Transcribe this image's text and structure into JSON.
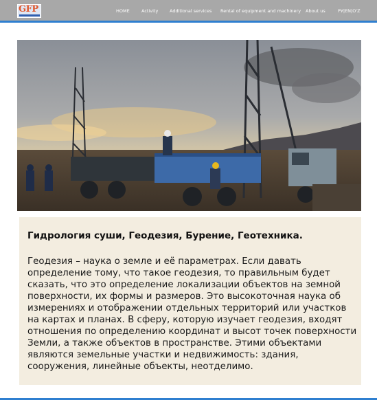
{
  "brand": {
    "logo_text": "GFP"
  },
  "nav": {
    "items": [
      "HOME",
      "Activity",
      "Additional services",
      "Rental of equipment and machinery",
      "About us",
      "РУ|EN|O'Z"
    ]
  },
  "colors": {
    "topbar": "#a8a8a8",
    "accent": "#2f7fd0",
    "text_panel": "#f3ede0"
  },
  "content": {
    "heading": "Гидрология суши, Геодезия, Бурение, Геотехника.",
    "paragraph": "Геодезия – наука о земле и её параметрах. Если давать определение тому, что такое геодезия, то правильным будет сказать, что это определение локализации объектов на земной поверхности, их формы и размеров. Это высокоточная наука об измерениях и отображении отдельных территорий или участков на картах и планах. В сферу, которую изучает геодезия, входят отношения по определению координат и высот точек поверхности Земли, а также объектов в пространстве. Этими объектами являются земельные участки и недвижимость: здания, сооружения, линейные объекты, неотделимо."
  }
}
